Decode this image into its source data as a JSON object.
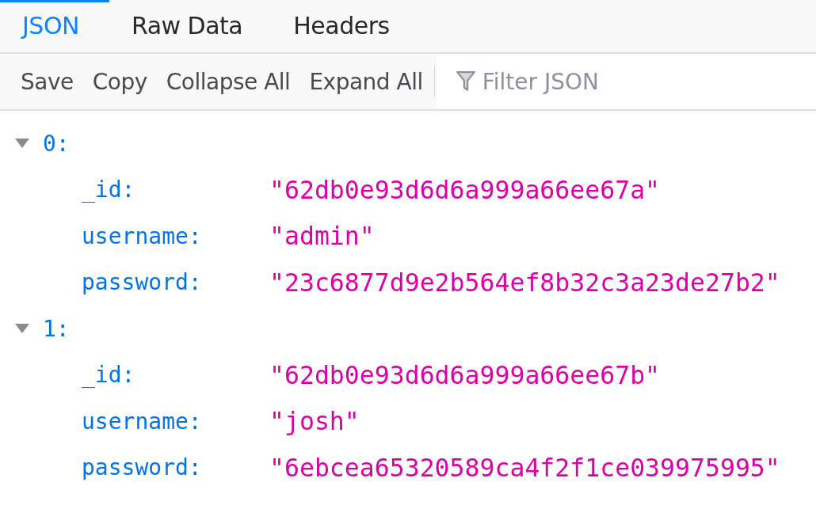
{
  "tabs": [
    {
      "label": "JSON",
      "selected": true
    },
    {
      "label": "Raw Data",
      "selected": false
    },
    {
      "label": "Headers",
      "selected": false
    }
  ],
  "toolbar": {
    "buttons": [
      "Save",
      "Copy",
      "Collapse All",
      "Expand All"
    ],
    "filter": {
      "placeholder": "Filter JSON"
    }
  },
  "tree": [
    {
      "key": "0:",
      "expanded": true,
      "children": [
        {
          "key": "_id:",
          "value": "\"62db0e93d6d6a999a66ee67a\""
        },
        {
          "key": "username:",
          "value": "\"admin\""
        },
        {
          "key": "password:",
          "value": "\"23c6877d9e2b564ef8b32c3a23de27b2\""
        }
      ]
    },
    {
      "key": "1:",
      "expanded": true,
      "children": [
        {
          "key": "_id:",
          "value": "\"62db0e93d6d6a999a66ee67b\""
        },
        {
          "key": "username:",
          "value": "\"josh\""
        },
        {
          "key": "password:",
          "value": "\"6ebcea65320589ca4f2f1ce039975995\""
        }
      ]
    }
  ]
}
